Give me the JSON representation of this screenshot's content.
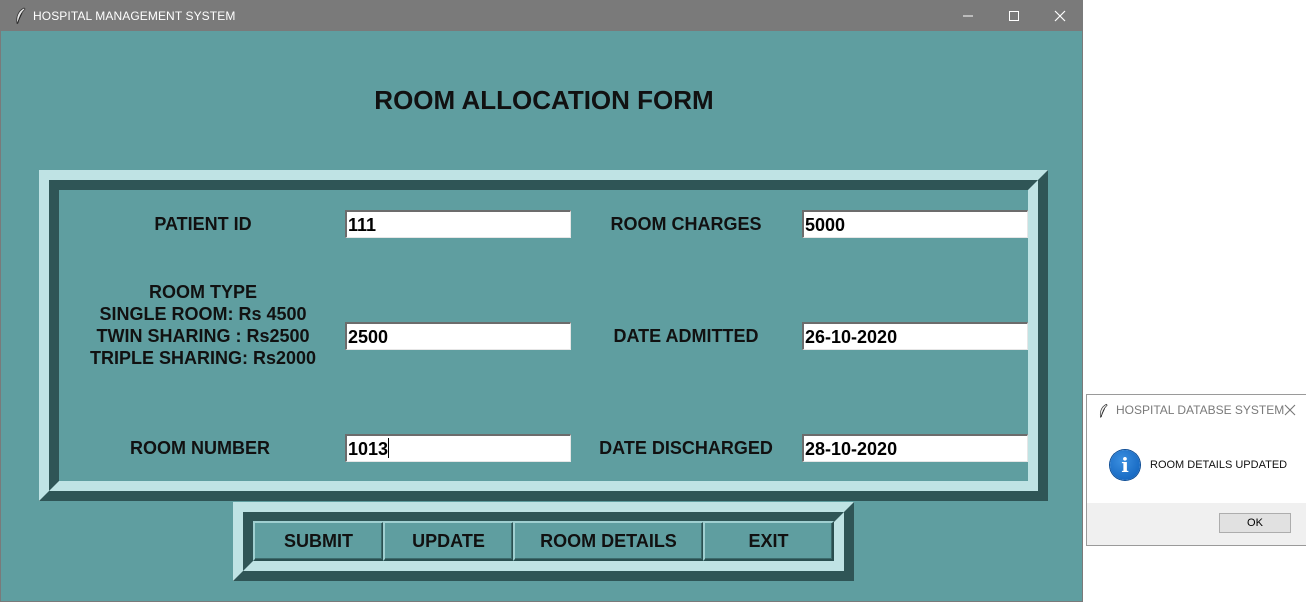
{
  "window": {
    "title": "HOSPITAL MANAGEMENT SYSTEM",
    "bg_color": "#5f9ea0",
    "icon": "feather-icon",
    "controls": [
      "minimize-icon",
      "maximize-icon",
      "close-icon"
    ]
  },
  "form": {
    "heading": "ROOM ALLOCATION FORM",
    "patient_id_label": "PATIENT ID",
    "patient_id_value": "111",
    "room_type_label": "ROOM TYPE",
    "room_type_single": "SINGLE ROOM: Rs 4500",
    "room_type_twin": "TWIN SHARING : Rs2500",
    "room_type_triple": "TRIPLE SHARING: Rs2000",
    "room_type_value": "2500",
    "room_number_label": "ROOM NUMBER",
    "room_number_value": "1013",
    "room_charges_label": "ROOM CHARGES",
    "room_charges_value": "5000",
    "date_admitted_label": "DATE ADMITTED",
    "date_admitted_value": "26-10-2020",
    "date_discharged_label": "DATE DISCHARGED",
    "date_discharged_value": "28-10-2020"
  },
  "buttons": {
    "submit": "SUBMIT",
    "update": "UPDATE",
    "room_details": "ROOM DETAILS",
    "exit": "EXIT"
  },
  "dialog": {
    "title": "HOSPITAL DATABSE SYSTEM",
    "message": "ROOM DETAILS UPDATED",
    "ok_label": "OK",
    "icon": "info-icon"
  }
}
